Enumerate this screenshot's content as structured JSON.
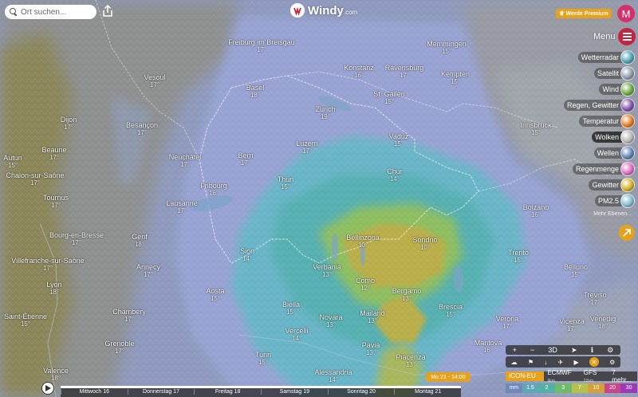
{
  "search": {
    "placeholder": "Ort suchen..."
  },
  "brand": {
    "name": "Windy",
    "suffix": ".com"
  },
  "premium_label": "Werde Premium",
  "avatar_initial": "M",
  "menu_label": "Menu",
  "layers": [
    {
      "label": "Wetterradar",
      "color": "#4aa0b0"
    },
    {
      "label": "Satellit",
      "color": "#8a9aa6"
    },
    {
      "label": "Wind",
      "color": "#6aa640"
    },
    {
      "label": "Regen, Gewitter",
      "color": "#7b4fa8"
    },
    {
      "label": "Temperatur",
      "color": "#e07a1f"
    },
    {
      "label": "Wolken",
      "color": "#b5b5b5",
      "active": true
    },
    {
      "label": "Wellen",
      "color": "#5d7fb0"
    },
    {
      "label": "Regenmenge",
      "color": "#d86abd"
    },
    {
      "label": "Gewitter",
      "color": "#d0b020"
    },
    {
      "label": "PM2.5",
      "color": "#7fb8c8"
    }
  ],
  "more_label": "Mehr Ebenen...",
  "map": {
    "cities": [
      {
        "name": "Basel",
        "temp": "18°"
      },
      {
        "name": "Zürich",
        "temp": "19°"
      },
      {
        "name": "Bern",
        "temp": "17°"
      },
      {
        "name": "Luzern",
        "temp": "17°"
      },
      {
        "name": "Lausanne",
        "temp": "17°"
      },
      {
        "name": "Genf",
        "temp": "18°"
      },
      {
        "name": "Dijon",
        "temp": "17°"
      },
      {
        "name": "Besançon",
        "temp": "17°"
      },
      {
        "name": "Beaune",
        "temp": "17°"
      },
      {
        "name": "Chalon-sur-Saône",
        "temp": "17°"
      },
      {
        "name": "Autun",
        "temp": "15°"
      },
      {
        "name": "Tournus",
        "temp": "17°"
      },
      {
        "name": "Bourg-en-Bresse",
        "temp": "17°"
      },
      {
        "name": "Villefranche-sur-Saône",
        "temp": "17°"
      },
      {
        "name": "Lyon",
        "temp": "18°"
      },
      {
        "name": "Saint-Étienne",
        "temp": "15°"
      },
      {
        "name": "Grenoble",
        "temp": "17°"
      },
      {
        "name": "Annecy",
        "temp": "17°"
      },
      {
        "name": "Chambéry",
        "temp": "17°"
      },
      {
        "name": "Valence",
        "temp": "18°"
      },
      {
        "name": "Aosta",
        "temp": "15°"
      },
      {
        "name": "Biella",
        "temp": "15°"
      },
      {
        "name": "Verbania",
        "temp": "13°"
      },
      {
        "name": "Como",
        "temp": "12°"
      },
      {
        "name": "Bellinzona",
        "temp": "10°"
      },
      {
        "name": "Sondrio",
        "temp": "10°"
      },
      {
        "name": "Bergamo",
        "temp": "13°"
      },
      {
        "name": "Brescia",
        "temp": "15°"
      },
      {
        "name": "Mailand",
        "temp": "13°"
      },
      {
        "name": "Novara",
        "temp": "13°"
      },
      {
        "name": "Turin",
        "temp": "15°"
      },
      {
        "name": "Pavia",
        "temp": "13°"
      },
      {
        "name": "Piacenza",
        "temp": "13°"
      },
      {
        "name": "Alessandria",
        "temp": "14°"
      },
      {
        "name": "Freiburg im Breisgau",
        "temp": "17°"
      },
      {
        "name": "Konstanz",
        "temp": "16°"
      },
      {
        "name": "Ravensburg",
        "temp": "17°"
      },
      {
        "name": "Kempten",
        "temp": "15°"
      },
      {
        "name": "Vaduz",
        "temp": "15°"
      },
      {
        "name": "Innsbruck",
        "temp": "15°"
      },
      {
        "name": "Bolzano",
        "temp": "16°"
      },
      {
        "name": "Trento",
        "temp": "15°"
      },
      {
        "name": "Verona",
        "temp": "17°"
      },
      {
        "name": "Venedig",
        "temp": "18°"
      },
      {
        "name": "Vicenza",
        "temp": "17°"
      },
      {
        "name": "Mantova",
        "temp": "16°"
      },
      {
        "name": "Memmingen",
        "temp": "15°"
      },
      {
        "name": "Chur",
        "temp": "14°"
      },
      {
        "name": "St. Gallen",
        "temp": "15°"
      },
      {
        "name": "Thun",
        "temp": "15°"
      },
      {
        "name": "Fribourg",
        "temp": "16°"
      },
      {
        "name": "Neuchâtel",
        "temp": "17°"
      },
      {
        "name": "Vesoul",
        "temp": "17°"
      },
      {
        "name": "Sion",
        "temp": "14°"
      },
      {
        "name": "Belluno",
        "temp": "15°"
      },
      {
        "name": "Treviso",
        "temp": "17°"
      },
      {
        "name": "Vercelli",
        "temp": "14°"
      }
    ]
  },
  "controls": {
    "row1": [
      "+",
      "−",
      "3D",
      "➤",
      "ℹ",
      "⚙"
    ],
    "row2": [
      "☁",
      "⚑",
      "↓",
      "✈",
      "▶",
      "✕",
      "⚙"
    ]
  },
  "models": [
    {
      "label": "ICON-EU",
      "sub": "7km",
      "selected": true
    },
    {
      "label": "ECMWF",
      "sub": "9km"
    },
    {
      "label": "GFS",
      "sub": "22km"
    },
    {
      "label": "7 mehr..."
    }
  ],
  "scale": {
    "unit": "mm",
    "stops": [
      "1.5",
      "2",
      "3",
      "7",
      "10",
      "20",
      "30"
    ],
    "colors": [
      "#6e88b8",
      "#5da7b6",
      "#52b1a2",
      "#6fbb6c",
      "#b6c14b",
      "#d5a03a",
      "#c7478a",
      "#9b3bb6"
    ]
  },
  "timeline": {
    "days": [
      "Mittwoch 16",
      "Donnerstag 17",
      "Freitag 18",
      "Samstag 19",
      "Sonntag 20",
      "Montag 21"
    ],
    "current": "Mo 21 - 14:00"
  },
  "colors": {
    "accent": "#e6a21b",
    "brand_red": "#c32540"
  }
}
